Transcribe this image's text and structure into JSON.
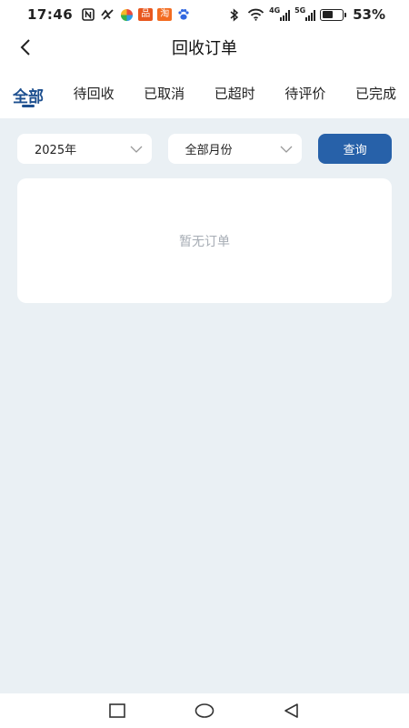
{
  "status_bar": {
    "time": "17:46",
    "left_icons": [
      "nfc-icon",
      "link-icon",
      "pinwheel-app-icon",
      "orange-app-icon",
      "taobao-app-icon",
      "paw-app-icon"
    ],
    "app_badges": [
      "品",
      "淘"
    ],
    "network_1": "4G",
    "network_2": "5G",
    "battery_level": 53,
    "battery_text": "53%"
  },
  "header": {
    "title": "回收订单",
    "back_icon": "chevron-left-icon"
  },
  "tabs": [
    {
      "label": "全部",
      "active": true
    },
    {
      "label": "待回收",
      "active": false
    },
    {
      "label": "已取消",
      "active": false
    },
    {
      "label": "已超时",
      "active": false
    },
    {
      "label": "待评价",
      "active": false
    },
    {
      "label": "已完成",
      "active": false
    }
  ],
  "filters": {
    "year": "2025年",
    "month": "全部月份",
    "dropdown_icon": "chevron-down-icon",
    "query_label": "查询"
  },
  "orders": {
    "empty_text": "暂无订单"
  },
  "colors": {
    "accent": "#2761a9",
    "active_tab": "#1d4f8f",
    "background": "#eaf0f4",
    "empty_text": "#a7adb5"
  },
  "system_nav": [
    "recents-square-icon",
    "home-circle-icon",
    "back-triangle-icon"
  ]
}
